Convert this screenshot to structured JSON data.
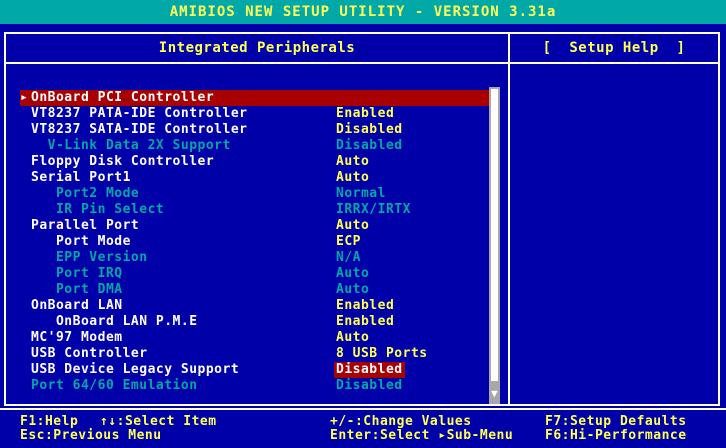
{
  "title": "AMIBIOS NEW SETUP UTILITY - VERSION 3.31a",
  "section_title": "Integrated Peripherals",
  "help_title": "[  Setup Help  ]",
  "selected_arrow": "▸",
  "items": [
    {
      "label": "OnBoard PCI Controller",
      "value": "",
      "style": "selected",
      "submenu": true
    },
    {
      "label": "VT8237 PATA-IDE Controller",
      "value": "Enabled",
      "style": "normal"
    },
    {
      "label": "VT8237 SATA-IDE Controller",
      "value": "Disabled",
      "style": "normal"
    },
    {
      "label": "  V-Link Data 2X Support",
      "value": "Disabled",
      "style": "dim"
    },
    {
      "label": "Floppy Disk Controller",
      "value": "Auto",
      "style": "normal"
    },
    {
      "label": "Serial Port1",
      "value": "Auto",
      "style": "normal"
    },
    {
      "label": "   Port2 Mode",
      "value": "Normal",
      "style": "dim"
    },
    {
      "label": "   IR Pin Select",
      "value": "IRRX/IRTX",
      "style": "dim"
    },
    {
      "label": "Parallel Port",
      "value": "Auto",
      "style": "normal"
    },
    {
      "label": "   Port Mode",
      "value": "ECP",
      "style": "normal"
    },
    {
      "label": "   EPP Version",
      "value": "N/A",
      "style": "dim"
    },
    {
      "label": "   Port IRQ",
      "value": "Auto",
      "style": "dim"
    },
    {
      "label": "   Port DMA",
      "value": "Auto",
      "style": "dim"
    },
    {
      "label": "OnBoard LAN",
      "value": "Enabled",
      "style": "normal"
    },
    {
      "label": "   OnBoard LAN P.M.E",
      "value": "Enabled",
      "style": "normal"
    },
    {
      "label": "MC'97 Modem",
      "value": "Auto",
      "style": "normal"
    },
    {
      "label": "USB Controller",
      "value": "8 USB Ports",
      "style": "normal"
    },
    {
      "label": "USB Device Legacy Support",
      "value": "Disabled",
      "style": "normal",
      "value_highlight": true
    },
    {
      "label": "Port 64/60 Emulation",
      "value": "Disabled",
      "style": "dim"
    }
  ],
  "footer": {
    "help": "F1:Help",
    "select_item": "↑↓:Select Item",
    "change_values": "+/-:Change Values",
    "setup_defaults": "F7:Setup Defaults",
    "previous_menu": "Esc:Previous Menu",
    "select_submenu": "Enter:Select ▸Sub-Menu",
    "hi_performance": "F6:Hi-Performance"
  },
  "scroll_down_arrow": "▼",
  "colors": {
    "background": "#0000a8",
    "title_bar": "#00a8a8",
    "title_text": "#ffff55",
    "item_label": "#ffffff",
    "item_value": "#ffff55",
    "item_dim": "#00a8a8",
    "highlight": "#a80000",
    "footer_text": "#55ffff"
  }
}
